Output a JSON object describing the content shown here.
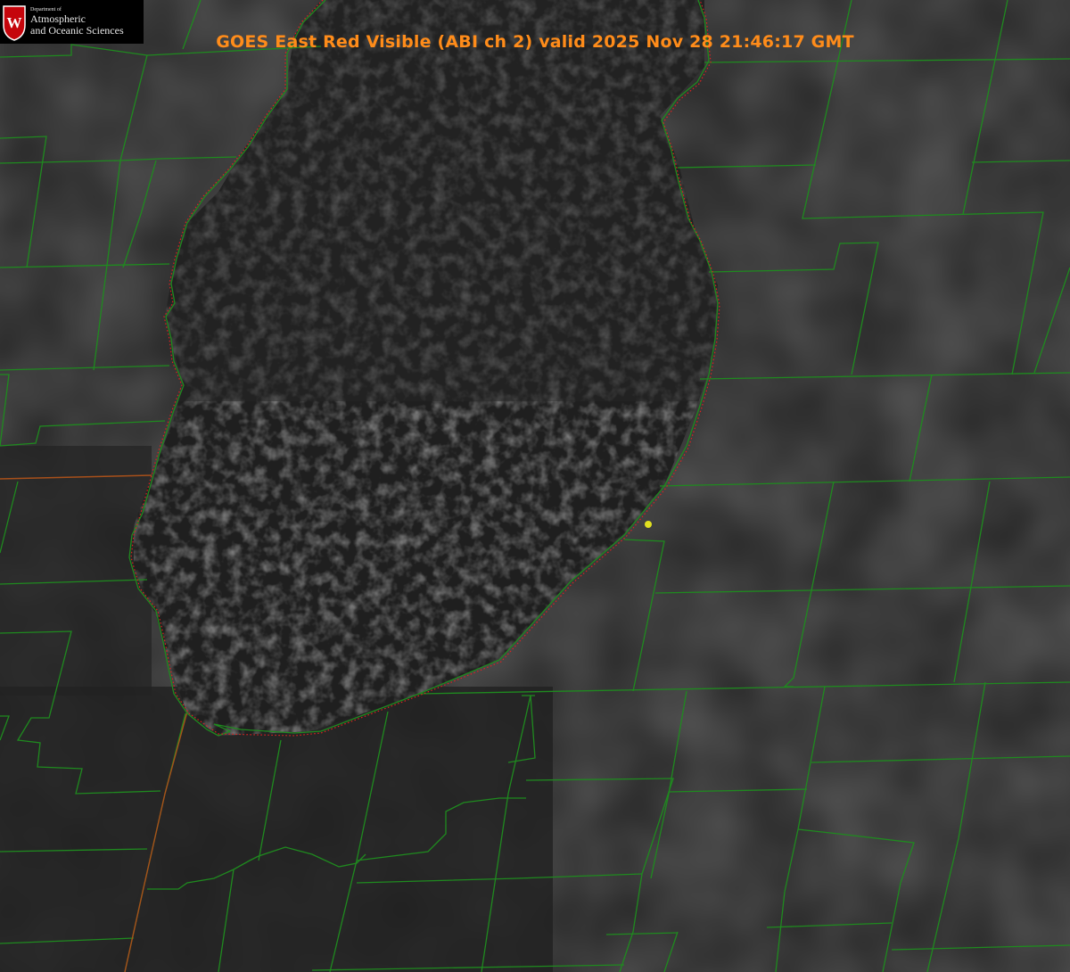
{
  "title": "GOES East Red Visible (ABI ch 2) valid 2025 Nov 28 21:46:17 GMT",
  "logo": {
    "dept": "Department of",
    "line1": "Atmospheric",
    "line2": "and Oceanic Sciences",
    "crest_letter": "W"
  },
  "colors": {
    "background": "#262626",
    "lake": "#1c1c1c",
    "county_lines": "#1f8a1f",
    "state_line": "#a83a1a",
    "shoreline_dotted": "#e02020",
    "marker": "#e0e020",
    "title": "#ff8c1a"
  },
  "layers": [
    "visible-satellite-imagery",
    "county-boundaries",
    "state-boundary",
    "lake-shoreline",
    "location-marker"
  ]
}
